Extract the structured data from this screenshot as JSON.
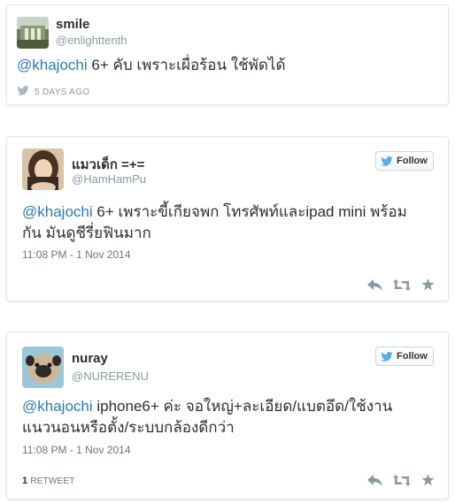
{
  "colors": {
    "link": "#2b7bb9",
    "bird": "#55acee",
    "muted": "#8899a6",
    "text": "#292f33"
  },
  "tweets": [
    {
      "name": "smile",
      "handle": "@enlighttenth",
      "mention": "@khajochi",
      "text": " 6+ คับ เพราะเผื่อร้อน ใช้พัดได้",
      "time": "5 DAYS AGO"
    },
    {
      "name": "แมวเด็ก =+=",
      "handle": "@HamHamPu",
      "mention": "@khajochi",
      "text": " 6+ เพราะขี้เกียจพก โทรศัพท์และipad mini พร้อมกัน มันดูชีรี่ยฟินมาก",
      "time": "11:08 PM - 1 Nov 2014",
      "follow_label": "Follow"
    },
    {
      "name": "nuray",
      "handle": "@NURERENU",
      "mention": "@khajochi",
      "text": " iphone6+ ค่ะ จอใหญ่+ละเอียด/แบตอึด/ใช้งานแนวนอนหรือตั้ง/ระบบกล้องดีกว่า",
      "time": "11:08 PM - 1 Nov 2014",
      "follow_label": "Follow",
      "retweet_count": "1",
      "retweet_label": "RETWEET"
    }
  ],
  "icons": {
    "bird": "twitter-bird-icon",
    "reply": "reply-icon",
    "retweet": "retweet-icon",
    "favorite": "favorite-star-icon"
  }
}
